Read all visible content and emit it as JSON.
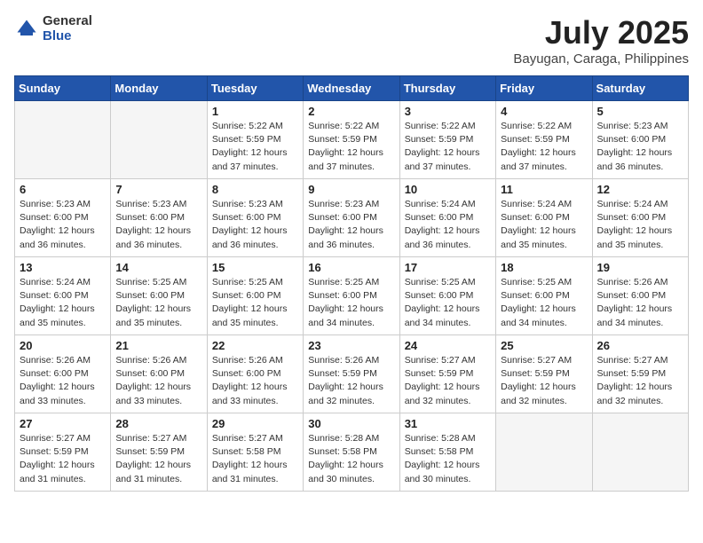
{
  "logo": {
    "general": "General",
    "blue": "Blue"
  },
  "title": "July 2025",
  "location": "Bayugan, Caraga, Philippines",
  "weekdays": [
    "Sunday",
    "Monday",
    "Tuesday",
    "Wednesday",
    "Thursday",
    "Friday",
    "Saturday"
  ],
  "weeks": [
    [
      {
        "day": "",
        "info": ""
      },
      {
        "day": "",
        "info": ""
      },
      {
        "day": "1",
        "info": "Sunrise: 5:22 AM\nSunset: 5:59 PM\nDaylight: 12 hours\nand 37 minutes."
      },
      {
        "day": "2",
        "info": "Sunrise: 5:22 AM\nSunset: 5:59 PM\nDaylight: 12 hours\nand 37 minutes."
      },
      {
        "day": "3",
        "info": "Sunrise: 5:22 AM\nSunset: 5:59 PM\nDaylight: 12 hours\nand 37 minutes."
      },
      {
        "day": "4",
        "info": "Sunrise: 5:22 AM\nSunset: 5:59 PM\nDaylight: 12 hours\nand 37 minutes."
      },
      {
        "day": "5",
        "info": "Sunrise: 5:23 AM\nSunset: 6:00 PM\nDaylight: 12 hours\nand 36 minutes."
      }
    ],
    [
      {
        "day": "6",
        "info": "Sunrise: 5:23 AM\nSunset: 6:00 PM\nDaylight: 12 hours\nand 36 minutes."
      },
      {
        "day": "7",
        "info": "Sunrise: 5:23 AM\nSunset: 6:00 PM\nDaylight: 12 hours\nand 36 minutes."
      },
      {
        "day": "8",
        "info": "Sunrise: 5:23 AM\nSunset: 6:00 PM\nDaylight: 12 hours\nand 36 minutes."
      },
      {
        "day": "9",
        "info": "Sunrise: 5:23 AM\nSunset: 6:00 PM\nDaylight: 12 hours\nand 36 minutes."
      },
      {
        "day": "10",
        "info": "Sunrise: 5:24 AM\nSunset: 6:00 PM\nDaylight: 12 hours\nand 36 minutes."
      },
      {
        "day": "11",
        "info": "Sunrise: 5:24 AM\nSunset: 6:00 PM\nDaylight: 12 hours\nand 35 minutes."
      },
      {
        "day": "12",
        "info": "Sunrise: 5:24 AM\nSunset: 6:00 PM\nDaylight: 12 hours\nand 35 minutes."
      }
    ],
    [
      {
        "day": "13",
        "info": "Sunrise: 5:24 AM\nSunset: 6:00 PM\nDaylight: 12 hours\nand 35 minutes."
      },
      {
        "day": "14",
        "info": "Sunrise: 5:25 AM\nSunset: 6:00 PM\nDaylight: 12 hours\nand 35 minutes."
      },
      {
        "day": "15",
        "info": "Sunrise: 5:25 AM\nSunset: 6:00 PM\nDaylight: 12 hours\nand 35 minutes."
      },
      {
        "day": "16",
        "info": "Sunrise: 5:25 AM\nSunset: 6:00 PM\nDaylight: 12 hours\nand 34 minutes."
      },
      {
        "day": "17",
        "info": "Sunrise: 5:25 AM\nSunset: 6:00 PM\nDaylight: 12 hours\nand 34 minutes."
      },
      {
        "day": "18",
        "info": "Sunrise: 5:25 AM\nSunset: 6:00 PM\nDaylight: 12 hours\nand 34 minutes."
      },
      {
        "day": "19",
        "info": "Sunrise: 5:26 AM\nSunset: 6:00 PM\nDaylight: 12 hours\nand 34 minutes."
      }
    ],
    [
      {
        "day": "20",
        "info": "Sunrise: 5:26 AM\nSunset: 6:00 PM\nDaylight: 12 hours\nand 33 minutes."
      },
      {
        "day": "21",
        "info": "Sunrise: 5:26 AM\nSunset: 6:00 PM\nDaylight: 12 hours\nand 33 minutes."
      },
      {
        "day": "22",
        "info": "Sunrise: 5:26 AM\nSunset: 6:00 PM\nDaylight: 12 hours\nand 33 minutes."
      },
      {
        "day": "23",
        "info": "Sunrise: 5:26 AM\nSunset: 5:59 PM\nDaylight: 12 hours\nand 32 minutes."
      },
      {
        "day": "24",
        "info": "Sunrise: 5:27 AM\nSunset: 5:59 PM\nDaylight: 12 hours\nand 32 minutes."
      },
      {
        "day": "25",
        "info": "Sunrise: 5:27 AM\nSunset: 5:59 PM\nDaylight: 12 hours\nand 32 minutes."
      },
      {
        "day": "26",
        "info": "Sunrise: 5:27 AM\nSunset: 5:59 PM\nDaylight: 12 hours\nand 32 minutes."
      }
    ],
    [
      {
        "day": "27",
        "info": "Sunrise: 5:27 AM\nSunset: 5:59 PM\nDaylight: 12 hours\nand 31 minutes."
      },
      {
        "day": "28",
        "info": "Sunrise: 5:27 AM\nSunset: 5:59 PM\nDaylight: 12 hours\nand 31 minutes."
      },
      {
        "day": "29",
        "info": "Sunrise: 5:27 AM\nSunset: 5:58 PM\nDaylight: 12 hours\nand 31 minutes."
      },
      {
        "day": "30",
        "info": "Sunrise: 5:28 AM\nSunset: 5:58 PM\nDaylight: 12 hours\nand 30 minutes."
      },
      {
        "day": "31",
        "info": "Sunrise: 5:28 AM\nSunset: 5:58 PM\nDaylight: 12 hours\nand 30 minutes."
      },
      {
        "day": "",
        "info": ""
      },
      {
        "day": "",
        "info": ""
      }
    ]
  ]
}
